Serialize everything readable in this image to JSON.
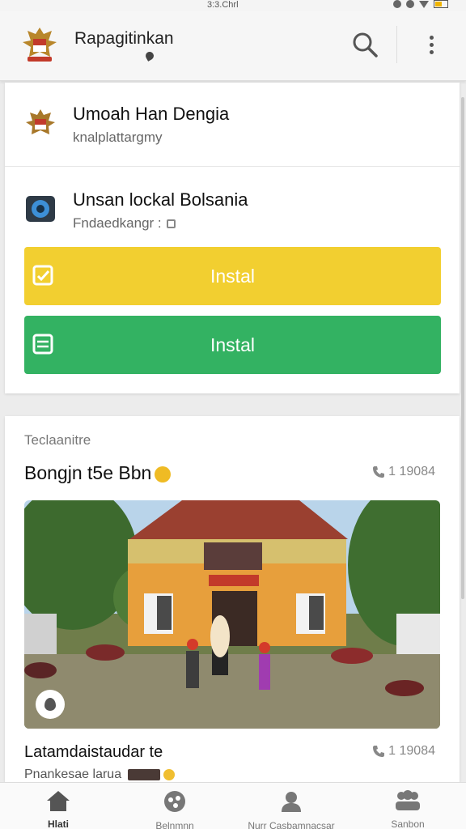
{
  "status_bar": {
    "time": "3:3.Chrl"
  },
  "app_bar": {
    "title": "Rapagitinkan"
  },
  "apps": [
    {
      "title": "Umoah Han Dengia",
      "subtitle": "knalplattargmy"
    },
    {
      "title": "Unsan lockal Bolsania",
      "subtitle": "Fndaedkangr :"
    }
  ],
  "buttons": {
    "yellow_label": "Instal",
    "green_label": "Instal"
  },
  "section": {
    "label": "Teclaanitre",
    "post_title": "Bongjn t5e Bbn",
    "post_phone": "1 19084",
    "post2_title": "Latamdaistaudar te",
    "post2_phone": "1 19084",
    "post2_subtitle": "Pnankesae larua"
  },
  "nav": [
    {
      "label": "Hlati",
      "icon": "home-icon"
    },
    {
      "label": "Belnmnn",
      "icon": "explore-icon"
    },
    {
      "label": "Nurr Casbamnacsar",
      "icon": "profile-icon"
    },
    {
      "label": "Sanbon",
      "icon": "group-icon"
    }
  ],
  "colors": {
    "yellow": "#f2cf30",
    "green": "#33b262",
    "accent_badge": "#efbb24"
  }
}
